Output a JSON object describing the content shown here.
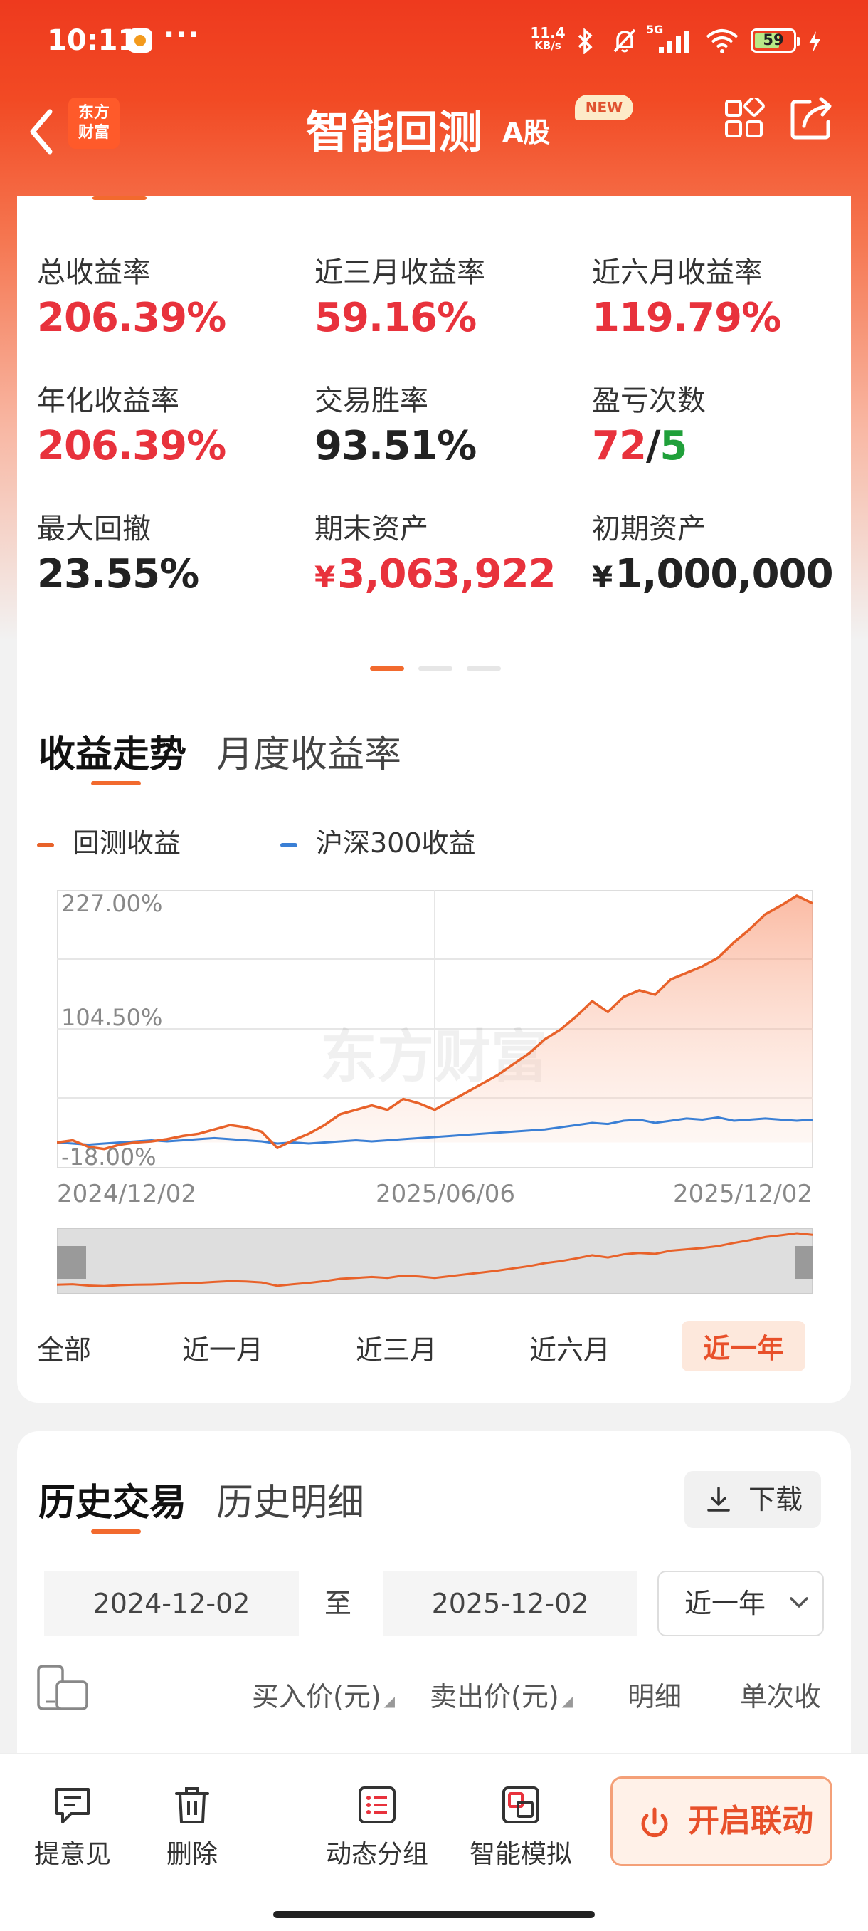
{
  "status_bar": {
    "time": "10:11",
    "more": "···",
    "net_speed_value": "11.4",
    "net_speed_unit": "KB/s",
    "signal_label": "5G",
    "battery": "59"
  },
  "nav": {
    "logo_line1": "东方",
    "logo_line2": "财富",
    "title": "智能回测",
    "title_suffix": "A股",
    "badge": "NEW"
  },
  "stats": [
    {
      "label": "总收益率",
      "value": "206.39%",
      "tone": "red"
    },
    {
      "label": "近三月收益率",
      "value": "59.16%",
      "tone": "red"
    },
    {
      "label": "近六月收益率",
      "value": "119.79%",
      "tone": "red"
    },
    {
      "label": "年化收益率",
      "value": "206.39%",
      "tone": "red"
    },
    {
      "label": "交易胜率",
      "value": "93.51%",
      "tone": "dark"
    },
    {
      "label": "盈亏次数",
      "value_win": "72",
      "value_sep": "/",
      "value_loss": "5"
    },
    {
      "label": "最大回撤",
      "value": "23.55%",
      "tone": "dark"
    },
    {
      "label": "期末资产",
      "currency": "¥",
      "value": "3,063,922",
      "tone": "red"
    },
    {
      "label": "初期资产",
      "currency": "¥",
      "value": "1,000,000",
      "tone": "dark"
    }
  ],
  "section_tabs": {
    "active": "收益走势",
    "inactive": "月度收益率"
  },
  "legend": {
    "series1": "回测收益",
    "series2": "沪深300收益"
  },
  "colors": {
    "accent": "#f26a2e",
    "series1": "#e8622a",
    "series2": "#3a7fd5",
    "profit": "#e8323c",
    "loss": "#20a03a"
  },
  "watermark": "东方财富",
  "chart_data": {
    "type": "line",
    "x_start": "2024/12/02",
    "x_mid": "2025/06/06",
    "x_end": "2025/12/02",
    "y_ticks": [
      "227.00%",
      "104.50%",
      "-18.00%"
    ],
    "ylim": [
      -18,
      227
    ],
    "grid": true,
    "series": [
      {
        "name": "回测收益",
        "values": [
          0,
          2,
          -4,
          -6,
          -2,
          0,
          1,
          3,
          6,
          8,
          12,
          16,
          14,
          10,
          -5,
          2,
          8,
          16,
          26,
          30,
          34,
          30,
          40,
          36,
          30,
          38,
          46,
          54,
          62,
          72,
          82,
          95,
          104,
          116,
          130,
          120,
          134,
          140,
          136,
          150,
          156,
          162,
          170,
          184,
          196,
          210,
          218,
          227,
          220
        ]
      },
      {
        "name": "沪深300收益",
        "values": [
          0,
          -1,
          -2,
          -1,
          0,
          1,
          2,
          1,
          2,
          3,
          4,
          3,
          2,
          1,
          -1,
          0,
          -1,
          0,
          1,
          2,
          1,
          2,
          3,
          4,
          5,
          6,
          7,
          8,
          9,
          10,
          11,
          12,
          14,
          16,
          18,
          17,
          20,
          21,
          18,
          20,
          22,
          21,
          23,
          20,
          21,
          22,
          21,
          20,
          21
        ]
      }
    ]
  },
  "range_buttons": [
    "全部",
    "近一月",
    "近三月",
    "近六月",
    "近一年"
  ],
  "history": {
    "tab_active": "历史交易",
    "tab_inactive": "历史明细",
    "download": "下载",
    "date_from": "2024-12-02",
    "to": "至",
    "date_to": "2025-12-02",
    "period": "近一年",
    "columns": [
      "买入价(元)",
      "卖出价(元)",
      "明细",
      "单次收"
    ]
  },
  "bottom_bar": {
    "feedback": "提意见",
    "delete": "删除",
    "group": "动态分组",
    "simulate": "智能模拟",
    "cta": "开启联动"
  }
}
